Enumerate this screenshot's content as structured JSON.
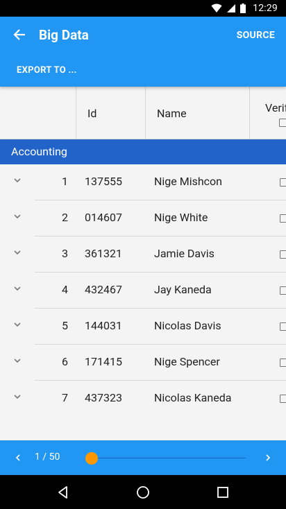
{
  "status_bar": {
    "time": "12:29"
  },
  "app_bar": {
    "title": "Big Data",
    "source_label": "SOURCE",
    "export_label": "EXPORT TO ..."
  },
  "table": {
    "columns": [
      "Id",
      "Name",
      "Verif"
    ],
    "group": "Accounting",
    "rows": [
      {
        "num": "1",
        "id": "137555",
        "name": "Nige Mishcon"
      },
      {
        "num": "2",
        "id": "014607",
        "name": "Nige White"
      },
      {
        "num": "3",
        "id": "361321",
        "name": "Jamie Davis"
      },
      {
        "num": "4",
        "id": "432467",
        "name": "Jay Kaneda"
      },
      {
        "num": "5",
        "id": "144031",
        "name": "Nicolas Davis"
      },
      {
        "num": "6",
        "id": "171415",
        "name": "Nige Spencer"
      },
      {
        "num": "7",
        "id": "437323",
        "name": "Nicolas Kaneda"
      }
    ]
  },
  "pager": {
    "label": "1 / 50",
    "current": 1,
    "total": 50
  },
  "colors": {
    "primary": "#2196f3",
    "group_header": "#2163c9",
    "accent": "#ff9800"
  },
  "icons": {
    "back": "arrow-left-icon",
    "expand": "chevron-down-icon",
    "prev": "chevron-left-icon",
    "next": "chevron-right-icon"
  }
}
